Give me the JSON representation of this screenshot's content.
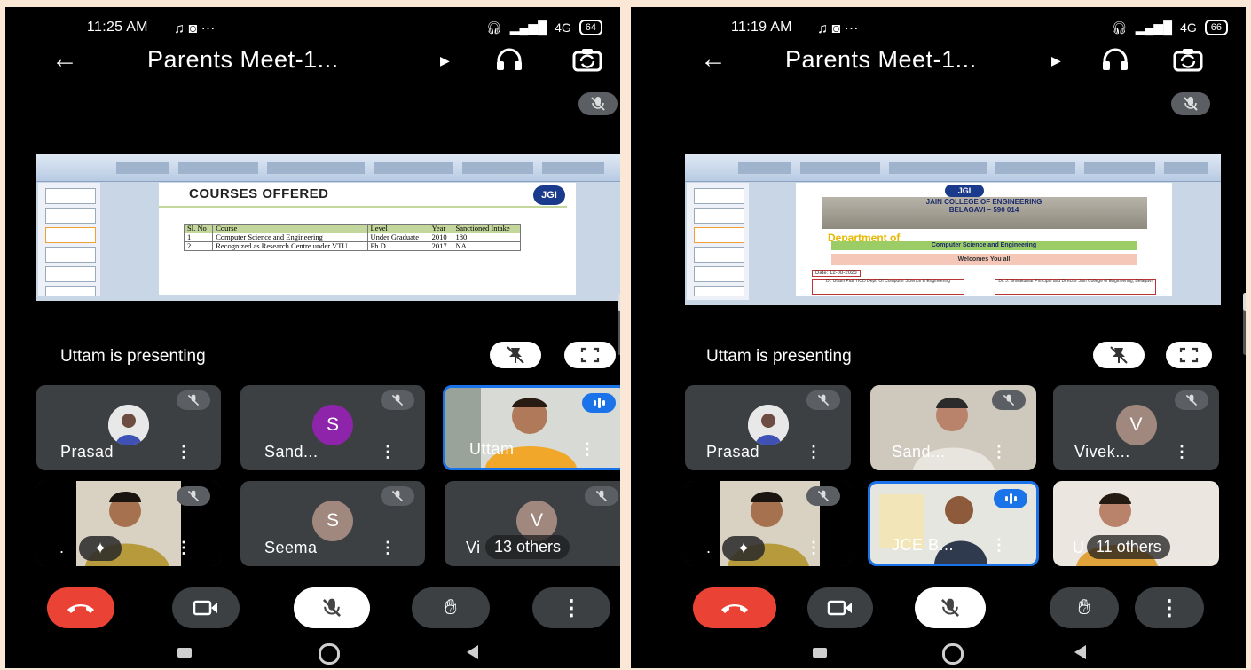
{
  "left": {
    "status": {
      "time": "11:25 AM",
      "icons": "♫  ◙  ⋯",
      "network": "4G",
      "battery": "64"
    },
    "meeting_title": "Parents Meet-1...",
    "presenting_label": "Uttam is presenting",
    "slide": {
      "title": "COURSES OFFERED",
      "logo": "JGI",
      "headers": [
        "Sl. No",
        "Course",
        "Level",
        "Year",
        "Sanctioned Intake"
      ],
      "rows": [
        [
          "1",
          "Computer Science and Engineering",
          "Under Graduate",
          "2010",
          "180"
        ],
        [
          "2",
          "Recognized as Research Centre under VTU",
          "Ph.D.",
          "2017",
          "NA"
        ]
      ]
    },
    "tiles": [
      {
        "name": "Prasad"
      },
      {
        "name": "Sand...",
        "initial": "S"
      },
      {
        "name": "Uttam"
      },
      {
        "name": "."
      },
      {
        "name": "Seema",
        "initial": "S"
      },
      {
        "name": "Vi",
        "initial": "V",
        "others": "13 others"
      }
    ]
  },
  "right": {
    "status": {
      "time": "11:19 AM",
      "icons": "♫  ◙  ⋯",
      "network": "4G",
      "battery": "66"
    },
    "meeting_title": "Parents Meet-1...",
    "presenting_label": "Uttam is presenting",
    "slide": {
      "logo": "JGI",
      "college": "JAIN COLLEGE OF ENGINEERING",
      "city": "BELAGAVI – 590 014",
      "dept": "Department of",
      "dept_name": "Computer Science and Engineering",
      "welcome": "Welcomes You all",
      "date": "Date: 12-08-2023",
      "sig_left": "Dr. Uttam Patil HOD Dept. Of Computer Science & Engineering",
      "sig_right": "Dr. J. Shivakumar Principal and Director Jain College of Engineering, Belagavi"
    },
    "tiles": [
      {
        "name": "Prasad"
      },
      {
        "name": "Sand..."
      },
      {
        "name": "Vivek...",
        "initial": "V"
      },
      {
        "name": "."
      },
      {
        "name": "JCE B..."
      },
      {
        "name": "U",
        "others": "11 others"
      }
    ]
  },
  "colors": {
    "end_call": "#ea4335",
    "speaking": "#1a73e8",
    "avatar_purple": "#8e24aa",
    "avatar_brown": "#a1887f",
    "tile_bg": "#3c4043"
  }
}
